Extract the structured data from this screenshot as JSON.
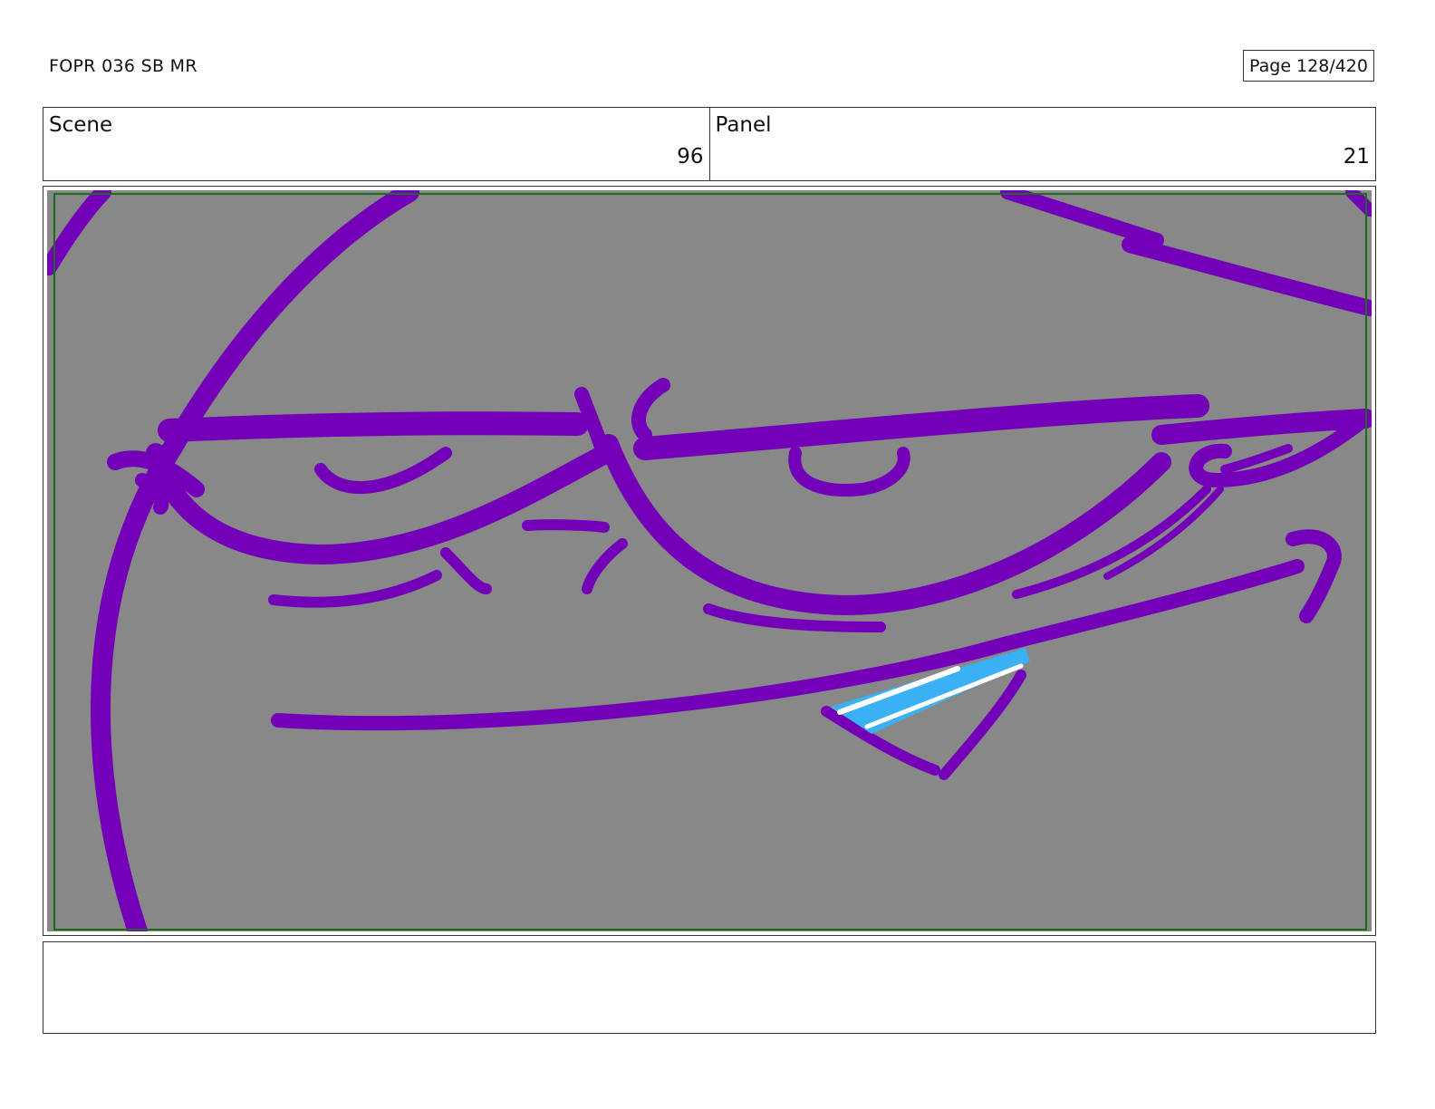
{
  "header": {
    "document_title": "FOPR 036 SB MR",
    "page_indicator": "Page 128/420"
  },
  "info": {
    "scene_label": "Scene",
    "scene_number": "96",
    "panel_label": "Panel",
    "panel_number": "21"
  },
  "artwork": {
    "background_color": "#888888",
    "stroke_color": "#7300b8",
    "accent_color": "#3ab0f5",
    "safe_frame_color": "#1e6b1e"
  },
  "notes": {
    "text": ""
  }
}
